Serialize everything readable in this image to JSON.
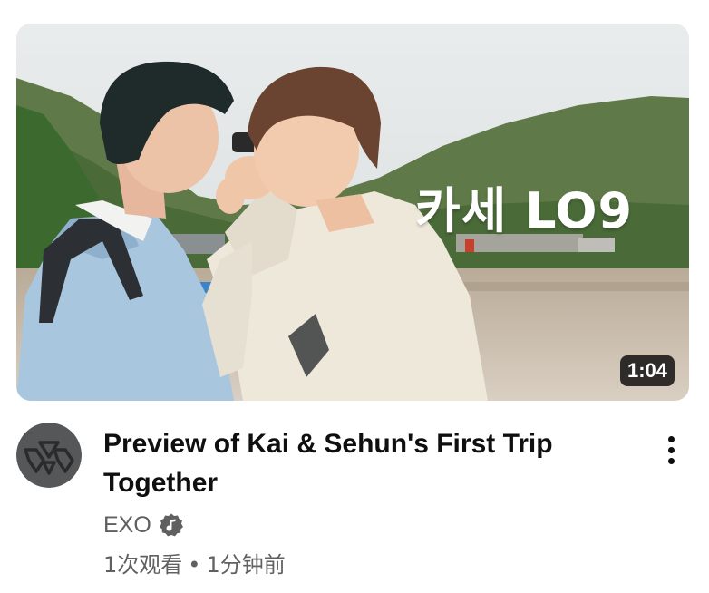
{
  "video": {
    "thumbnail": {
      "logo_text": "카세 LO9",
      "duration": "1:04"
    },
    "title": "Preview of Kai & Sehun's First Trip Together",
    "channel": {
      "name": "EXO",
      "verified_icon": "verified-music-note-icon"
    },
    "stats": {
      "views": "1次观看",
      "separator": "•",
      "age": "1分钟前"
    },
    "more_icon": "more-vertical-icon"
  },
  "colors": {
    "title": "#0f0f0f",
    "secondary_text": "#606060",
    "badge_bg": "#000000"
  }
}
